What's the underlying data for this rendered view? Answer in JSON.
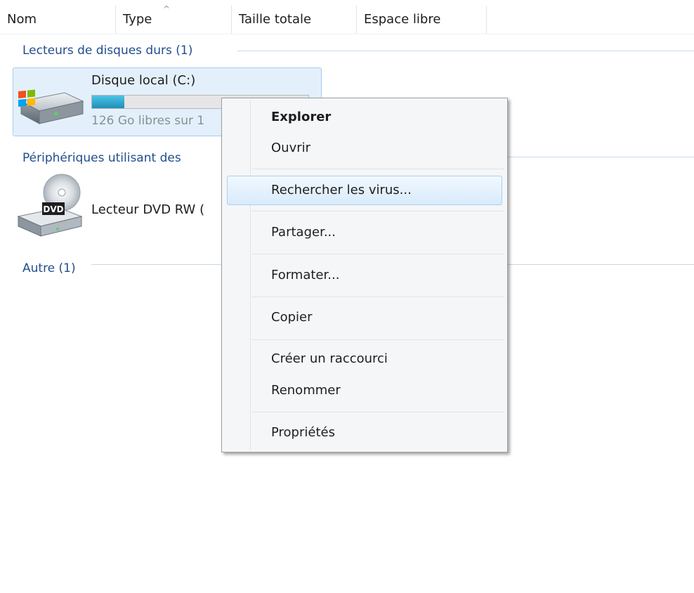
{
  "columns": {
    "name": "Nom",
    "type": "Type",
    "total_size": "Taille totale",
    "free_space": "Espace libre"
  },
  "groups": {
    "hard_drives": "Lecteurs de disques durs (1)",
    "removable": "Périphériques utilisant des",
    "other": "Autre (1)"
  },
  "drives": {
    "local_disk": {
      "name": "Disque local (C:)",
      "free_text": "126 Go libres sur 1",
      "used_fraction": 0.15
    },
    "dvd": {
      "name": "Lecteur DVD RW (",
      "badge": "DVD"
    }
  },
  "context_menu": {
    "explore": "Explorer",
    "open": "Ouvrir",
    "scan_virus": "Rechercher les virus...",
    "share": "Partager...",
    "format": "Formater...",
    "copy": "Copier",
    "create_shortcut": "Créer un raccourci",
    "rename": "Renommer",
    "properties": "Propriétés"
  },
  "colors": {
    "group_text": "#1f4e8c",
    "selection": "#e3f0fb",
    "highlight_border": "#a8d1f2"
  }
}
